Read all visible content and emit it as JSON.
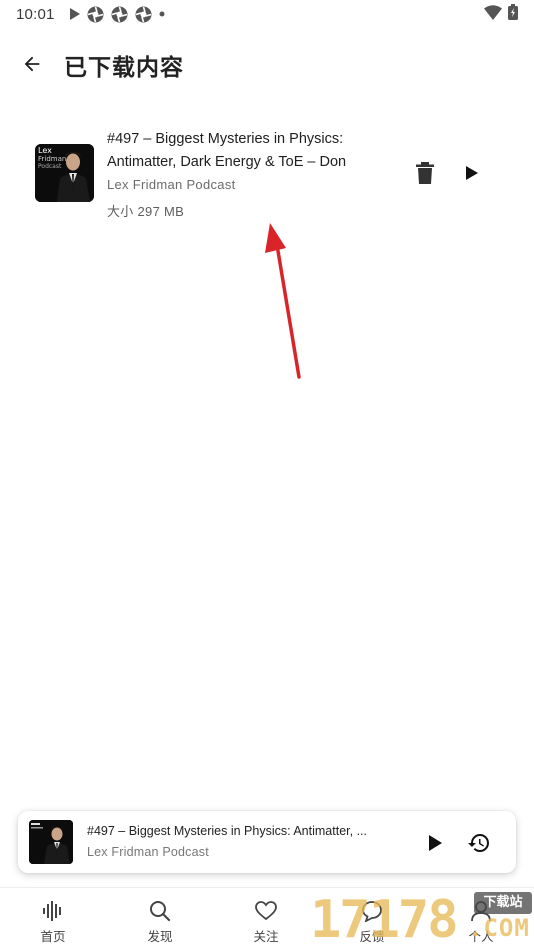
{
  "status_bar": {
    "time": "10:01"
  },
  "header": {
    "title": "已下载内容"
  },
  "episode": {
    "artwork_text": [
      "Lex",
      "Fridman",
      "Podcast"
    ],
    "title": "#497 – Biggest Mysteries in Physics: Antimatter, Dark Energy & ToE – Don",
    "podcast": "Lex Fridman Podcast",
    "size": "大小 297 MB"
  },
  "mini_player": {
    "title": "#497 – Biggest Mysteries in Physics: Antimatter, ...",
    "podcast": "Lex Fridman Podcast"
  },
  "bottom_nav": {
    "items": [
      {
        "label": "首页",
        "icon": "waveform-icon"
      },
      {
        "label": "发现",
        "icon": "search-icon"
      },
      {
        "label": "关注",
        "icon": "heart-icon"
      },
      {
        "label": "反馈",
        "icon": "chat-icon"
      },
      {
        "label": "个人",
        "icon": "person-icon"
      }
    ]
  },
  "watermark": {
    "digits": "17178",
    "site": "下载站",
    "suffix": ".COM"
  },
  "colors": {
    "annotation_arrow": "#d9252a",
    "watermark": "#e8ba5a"
  }
}
